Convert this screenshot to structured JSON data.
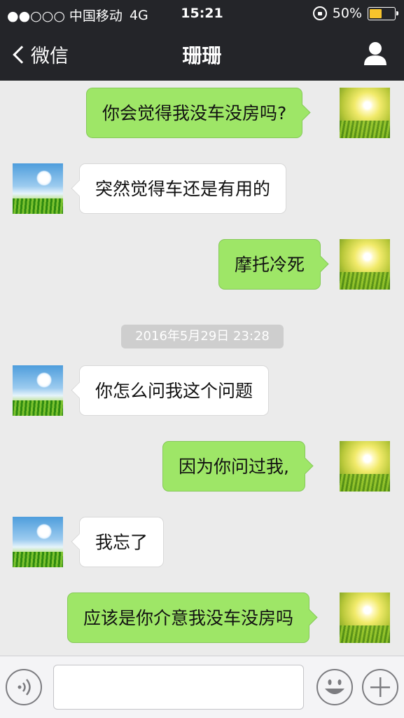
{
  "status_bar": {
    "carrier": "●●○○○ 中国移动",
    "network": "4G",
    "time": "15:21",
    "battery": "50%",
    "battery_level": 0.5
  },
  "nav": {
    "back_label": "微信",
    "title": "珊珊",
    "contact_icon": "person-icon"
  },
  "messages": [
    {
      "side": "out",
      "text": "你会觉得我没车没房吗?"
    },
    {
      "side": "in",
      "text": "突然觉得车还是有用的"
    },
    {
      "side": "out",
      "text": "摩托冷死"
    },
    {
      "side": "in",
      "text": "你怎么问我这个问题"
    },
    {
      "side": "out",
      "text": "因为你问过我,"
    },
    {
      "side": "in",
      "text": "我忘了"
    },
    {
      "side": "out",
      "text": "应该是你介意我没车没房吗"
    }
  ],
  "timestamp": "2016年5月29日 23:28",
  "input_bar": {
    "voice_icon": "voice-icon",
    "emoji_icon": "emoji-icon",
    "plus_icon": "plus-icon",
    "text_value": ""
  },
  "colors": {
    "bar_bg": "#242529",
    "outgoing_bubble": "#9ee667",
    "incoming_bubble": "#ffffff",
    "chat_bg": "#ebebeb",
    "battery_fill": "#f7c42c"
  }
}
